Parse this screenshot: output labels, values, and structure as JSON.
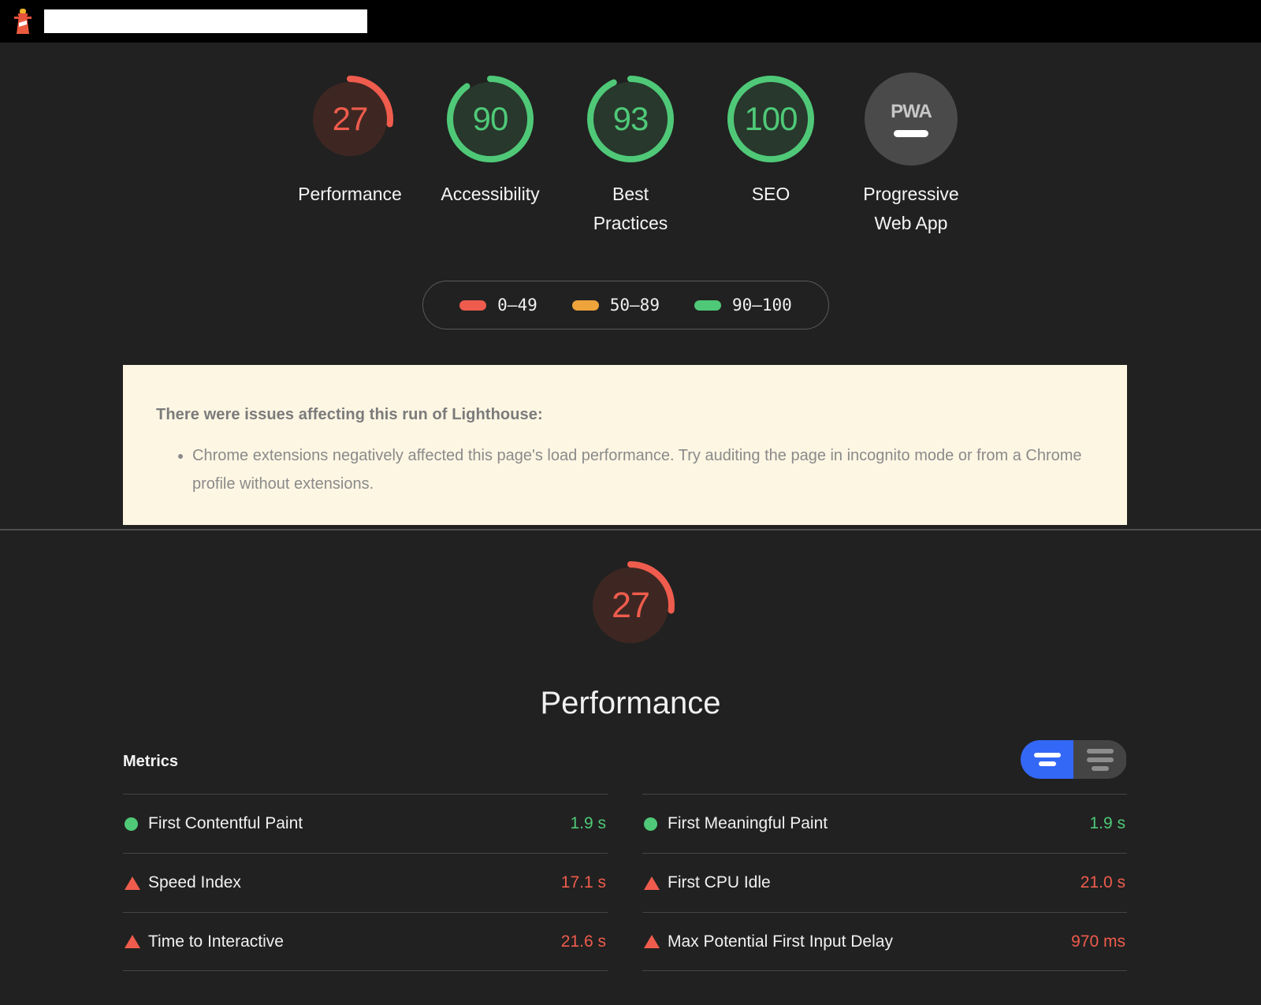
{
  "topbar": {
    "logo_icon": "lighthouse-icon",
    "url_value": "",
    "url_placeholder": ""
  },
  "scores": {
    "items": [
      {
        "label": "Performance",
        "score": "27",
        "value": 27,
        "rating": "fail",
        "color": "#ef5c4d",
        "track": "#3e2722"
      },
      {
        "label": "Accessibility",
        "score": "90",
        "value": 90,
        "rating": "pass",
        "color": "#4fc978",
        "track": "#28382c"
      },
      {
        "label": "Best\nPractices",
        "score": "93",
        "value": 93,
        "rating": "pass",
        "color": "#4fc978",
        "track": "#28382c"
      },
      {
        "label": "SEO",
        "score": "100",
        "value": 100,
        "rating": "pass",
        "color": "#4fc978",
        "track": "#28382c"
      },
      {
        "label": "Progressive\nWeb App",
        "score": "",
        "value": 0,
        "rating": "pwa",
        "color": "#4a4a4a",
        "track": "#4a4a4a",
        "badge_text": "PWA"
      }
    ]
  },
  "legend": {
    "items": [
      {
        "range": "0–49",
        "color": "#ef5c4d"
      },
      {
        "range": "50–89",
        "color": "#efa33b"
      },
      {
        "range": "90–100",
        "color": "#4fc978"
      }
    ]
  },
  "banner": {
    "title": "There were issues affecting this run of Lighthouse:",
    "items": [
      "Chrome extensions negatively affected this page's load performance. Try auditing the page in incognito mode or from a Chrome profile without extensions."
    ],
    "background": "#fdf6e3"
  },
  "performance_section": {
    "gauge_score": "27",
    "gauge_value": 27,
    "gauge_color": "#ef5c4d",
    "gauge_track": "#3e2722",
    "title": "Performance"
  },
  "metrics": {
    "title": "Metrics",
    "toggle": {
      "active_view": "filmstrip-view",
      "inactive_view": "list-view",
      "active_color": "#3367f6",
      "inactive_color": "#444444"
    },
    "columns": [
      {
        "rows": [
          {
            "icon": "pass-circle-icon",
            "name": "First Contentful Paint",
            "value": "1.9 s",
            "rating": "pass"
          },
          {
            "icon": "fail-triangle-icon",
            "name": "Speed Index",
            "value": "17.1 s",
            "rating": "fail"
          },
          {
            "icon": "fail-triangle-icon",
            "name": "Time to Interactive",
            "value": "21.6 s",
            "rating": "fail"
          }
        ]
      },
      {
        "rows": [
          {
            "icon": "pass-circle-icon",
            "name": "First Meaningful Paint",
            "value": "1.9 s",
            "rating": "pass"
          },
          {
            "icon": "fail-triangle-icon",
            "name": "First CPU Idle",
            "value": "21.0 s",
            "rating": "fail"
          },
          {
            "icon": "fail-triangle-icon",
            "name": "Max Potential First Input Delay",
            "value": "970 ms",
            "rating": "fail"
          }
        ]
      }
    ]
  }
}
